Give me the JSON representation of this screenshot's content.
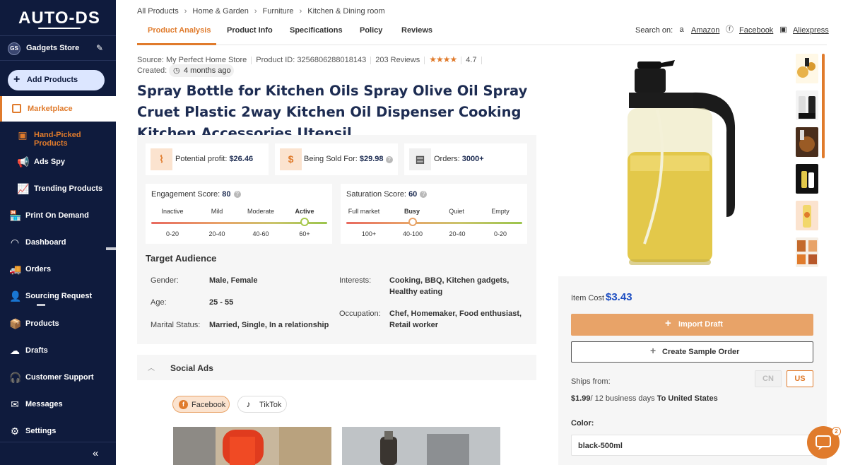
{
  "sidebar": {
    "logo": "AUTO-DS",
    "store": {
      "initials": "GS",
      "name": "Gadgets Store"
    },
    "add_products": "Add Products",
    "marketplace": "Marketplace",
    "items": [
      {
        "label": "Hand-Picked Products",
        "icon": "hand-picked-icon"
      },
      {
        "label": "Ads Spy",
        "icon": "megaphone-icon"
      },
      {
        "label": "Trending Products",
        "icon": "trending-icon"
      },
      {
        "label": "Print On Demand",
        "icon": "store-icon"
      },
      {
        "label": "Dashboard",
        "icon": "gauge-icon"
      },
      {
        "label": "Orders",
        "icon": "truck-icon"
      },
      {
        "label": "Sourcing Request",
        "icon": "user-search-icon"
      },
      {
        "label": "Products",
        "icon": "box-icon"
      },
      {
        "label": "Drafts",
        "icon": "cloud-upload-icon"
      },
      {
        "label": "Customer Support",
        "icon": "headset-icon"
      },
      {
        "label": "Messages",
        "icon": "mail-icon"
      },
      {
        "label": "Settings",
        "icon": "gear-icon"
      }
    ],
    "collapse": "«"
  },
  "breadcrumb": [
    "All Products",
    "Home & Garden",
    "Furniture",
    "Kitchen & Dining room"
  ],
  "tabs": [
    "Product Analysis",
    "Product Info",
    "Specifications",
    "Policy",
    "Reviews"
  ],
  "search_on": {
    "label": "Search on:",
    "links": [
      "Amazon",
      "Facebook",
      "Aliexpress"
    ]
  },
  "meta": {
    "source": "Source: My Perfect Home Store",
    "product_id": "Product ID: 3256806288018143",
    "reviews": "203 Reviews",
    "stars": "★★★★",
    "rating": "4.7",
    "created_label": "Created:",
    "created_value": "4 months ago"
  },
  "title": "Spray Bottle for Kitchen Oils Spray Olive Oil Spray Cruet Plastic 2way Kitchen Oil Dispenser Cooking Kitchen Accessories Utensil",
  "stats": {
    "profit_label": "Potential profit:",
    "profit_value": "$26.46",
    "sold_label": "Being Sold For:",
    "sold_value": "$29.98",
    "orders_label": "Orders:",
    "orders_value": "3000+"
  },
  "engagement": {
    "label": "Engagement Score:",
    "value": "80",
    "levels": [
      "Inactive",
      "Mild",
      "Moderate",
      "Active"
    ],
    "ranges": [
      "0-20",
      "20-40",
      "40-60",
      "60+"
    ]
  },
  "saturation": {
    "label": "Saturation Score:",
    "value": "60",
    "levels": [
      "Full market",
      "Busy",
      "Quiet",
      "Empty"
    ],
    "ranges": [
      "100+",
      "40-100",
      "20-40",
      "0-20"
    ]
  },
  "audience": {
    "title": "Target Audience",
    "gender_label": "Gender:",
    "gender": "Male, Female",
    "age_label": "Age:",
    "age": "25 - 55",
    "marital_label": "Marital Status:",
    "marital": "Married, Single, In a relationship",
    "interests_label": "Interests:",
    "interests": "Cooking, BBQ, Kitchen gadgets, Healthy eating",
    "occupation_label": "Occupation:",
    "occupation": "Chef, Homemaker, Food enthusiast, Retail worker"
  },
  "social": {
    "title": "Social Ads",
    "platforms": [
      "Facebook",
      "TikTok"
    ]
  },
  "pricing": {
    "cost_label": "Item Cost",
    "cost_value": "$3.43",
    "import": "Import Draft",
    "sample": "Create Sample Order",
    "ships_from": "Ships from:",
    "countries": [
      "CN",
      "US"
    ],
    "ship_price": "$1.99",
    "ship_days": "/ 12 business days",
    "ship_to": "To United States",
    "color_label": "Color:",
    "color_value": "black-500ml"
  },
  "chat_badge": "2",
  "colors": {
    "accent": "#e07b2c",
    "navy": "#0f1b3d",
    "price_blue": "#1d4ec2"
  }
}
